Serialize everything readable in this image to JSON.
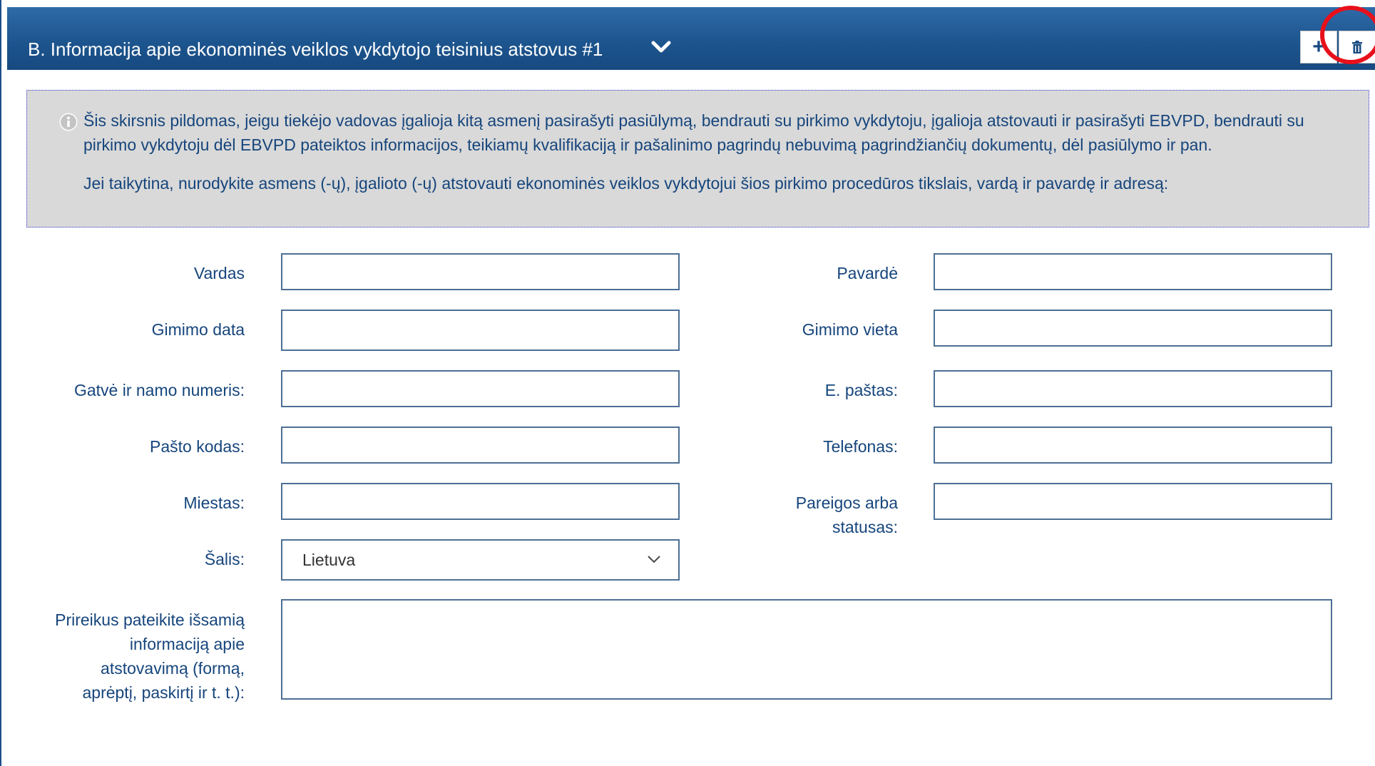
{
  "header": {
    "title": "B. Informacija apie ekonominės veiklos vykdytojo teisinius atstovus #1",
    "add_label": "+",
    "delete_icon": "trash-icon",
    "expand_icon": "chevron-down-icon"
  },
  "info": {
    "icon": "info-icon",
    "paragraph1": "Šis skirsnis pildomas, jeigu tiekėjo vadovas įgalioja kitą asmenį pasirašyti pasiūlymą, bendrauti su pirkimo vykdytoju, įgalioja atstovauti ir pasirašyti EBVPD, bendrauti su pirkimo vykdytoju dėl EBVPD pateiktos informacijos, teikiamų kvalifikaciją ir pašalinimo pagrindų nebuvimą pagrindžiančių dokumentų, dėl pasiūlymo ir pan.",
    "paragraph2": "Jei taikytina, nurodykite asmens (-ų), įgalioto (-ų) atstovauti ekonominės veiklos vykdytojui šios pirkimo procedūros tikslais, vardą ir pavardę ir adresą:"
  },
  "form": {
    "first_name": {
      "label": "Vardas",
      "value": ""
    },
    "last_name": {
      "label": "Pavardė",
      "value": ""
    },
    "birth_date": {
      "label": "Gimimo data",
      "value": ""
    },
    "birth_place": {
      "label": "Gimimo vieta",
      "value": ""
    },
    "street": {
      "label": "Gatvė ir namo numeris:",
      "value": ""
    },
    "email": {
      "label": "E. paštas:",
      "value": ""
    },
    "postal_code": {
      "label": "Pašto kodas:",
      "value": ""
    },
    "phone": {
      "label": "Telefonas:",
      "value": ""
    },
    "city": {
      "label": "Miestas:",
      "value": ""
    },
    "position": {
      "label": "Pareigos arba statusas:",
      "value": ""
    },
    "country": {
      "label": "Šalis:",
      "value": "Lietuva"
    },
    "details": {
      "label": "Prireikus pateikite išsamią informaciją apie atstovavimą (formą, aprėptį, paskirtį ir t. t.):",
      "value": ""
    }
  },
  "colors": {
    "header_bg": "#1d558f",
    "label_text": "#16457c",
    "info_bg": "#d9d9d9",
    "highlight": "#e8101a"
  }
}
